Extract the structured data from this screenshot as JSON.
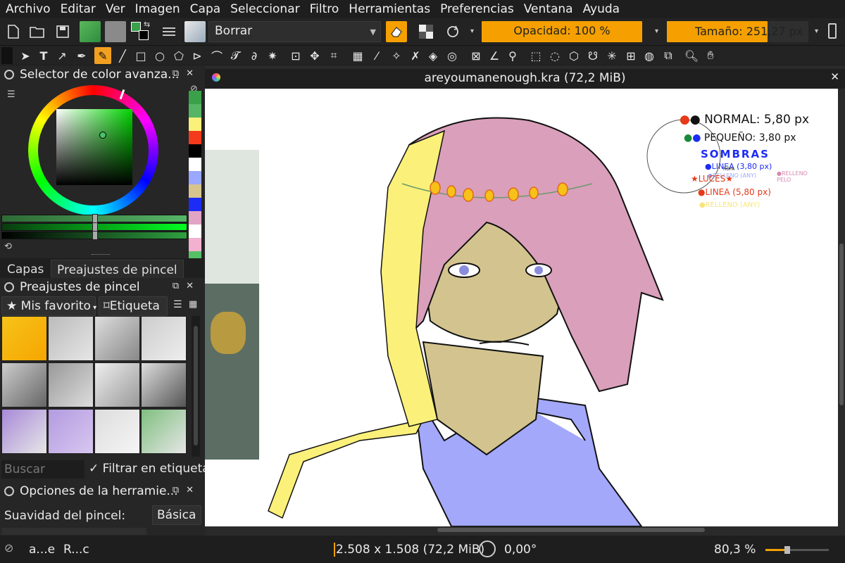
{
  "menu": [
    "Archivo",
    "Editar",
    "Ver",
    "Imagen",
    "Capa",
    "Seleccionar",
    "Filtro",
    "Herramientas",
    "Preferencias",
    "Ventana",
    "Ayuda"
  ],
  "options_bar": {
    "brush_preset": "Borrar",
    "opacity": "Opacidad: 100 %",
    "size": "Tamaño: 251,27 px"
  },
  "left_dock": {
    "color_panel_title": "Selector de color avanza...",
    "selected_color": "#49c06a",
    "swatches": [
      "#3aa04a",
      "#55b565",
      "#fbf07a",
      "#f43a1c",
      "#000000",
      "#ffffff",
      "#9aa8ff",
      "#d7c48e",
      "#1b2cf6",
      "#e2a4c4",
      "#ffffff",
      "#f2b1cf",
      "#55c066"
    ],
    "tabs": [
      "Capas",
      "Preajustes de pincel"
    ],
    "brush_panel_title": "Preajustes de pincel",
    "tag_filter": "Mis favorito",
    "tag_button": "Etiqueta",
    "search_placeholder": "Buscar",
    "filter_tag_label": "Filtrar en etiqueta",
    "tool_options_title": "Opciones de la herramie...",
    "smoothing_label": "Suavidad del pincel:",
    "smoothing_value": "Básica"
  },
  "document": {
    "title": "areyoumanenough.kra (72,2 MiB)",
    "annotations": {
      "normal": "NORMAL: 5,80 px",
      "small": "PEQUEÑO: 3,80 px",
      "shadows": "SOMBRAS",
      "line_shadow": "LINEA (3,80 px)",
      "fill_any": "RELLENO (ANY)",
      "ropa": "ROPA",
      "relleno_pelo": "RELLENO PELO",
      "lights": "LUCES",
      "line_light": "LINEA (5,80 px)",
      "fill_light": "RELLENO (ANY)"
    }
  },
  "status_bar": {
    "layer_a": "a...e",
    "layer_b": "R...c",
    "dimensions": "2.508 x 1.508 (72,2 MiB)",
    "rotation": "0,00°",
    "zoom": "80,3 %"
  }
}
